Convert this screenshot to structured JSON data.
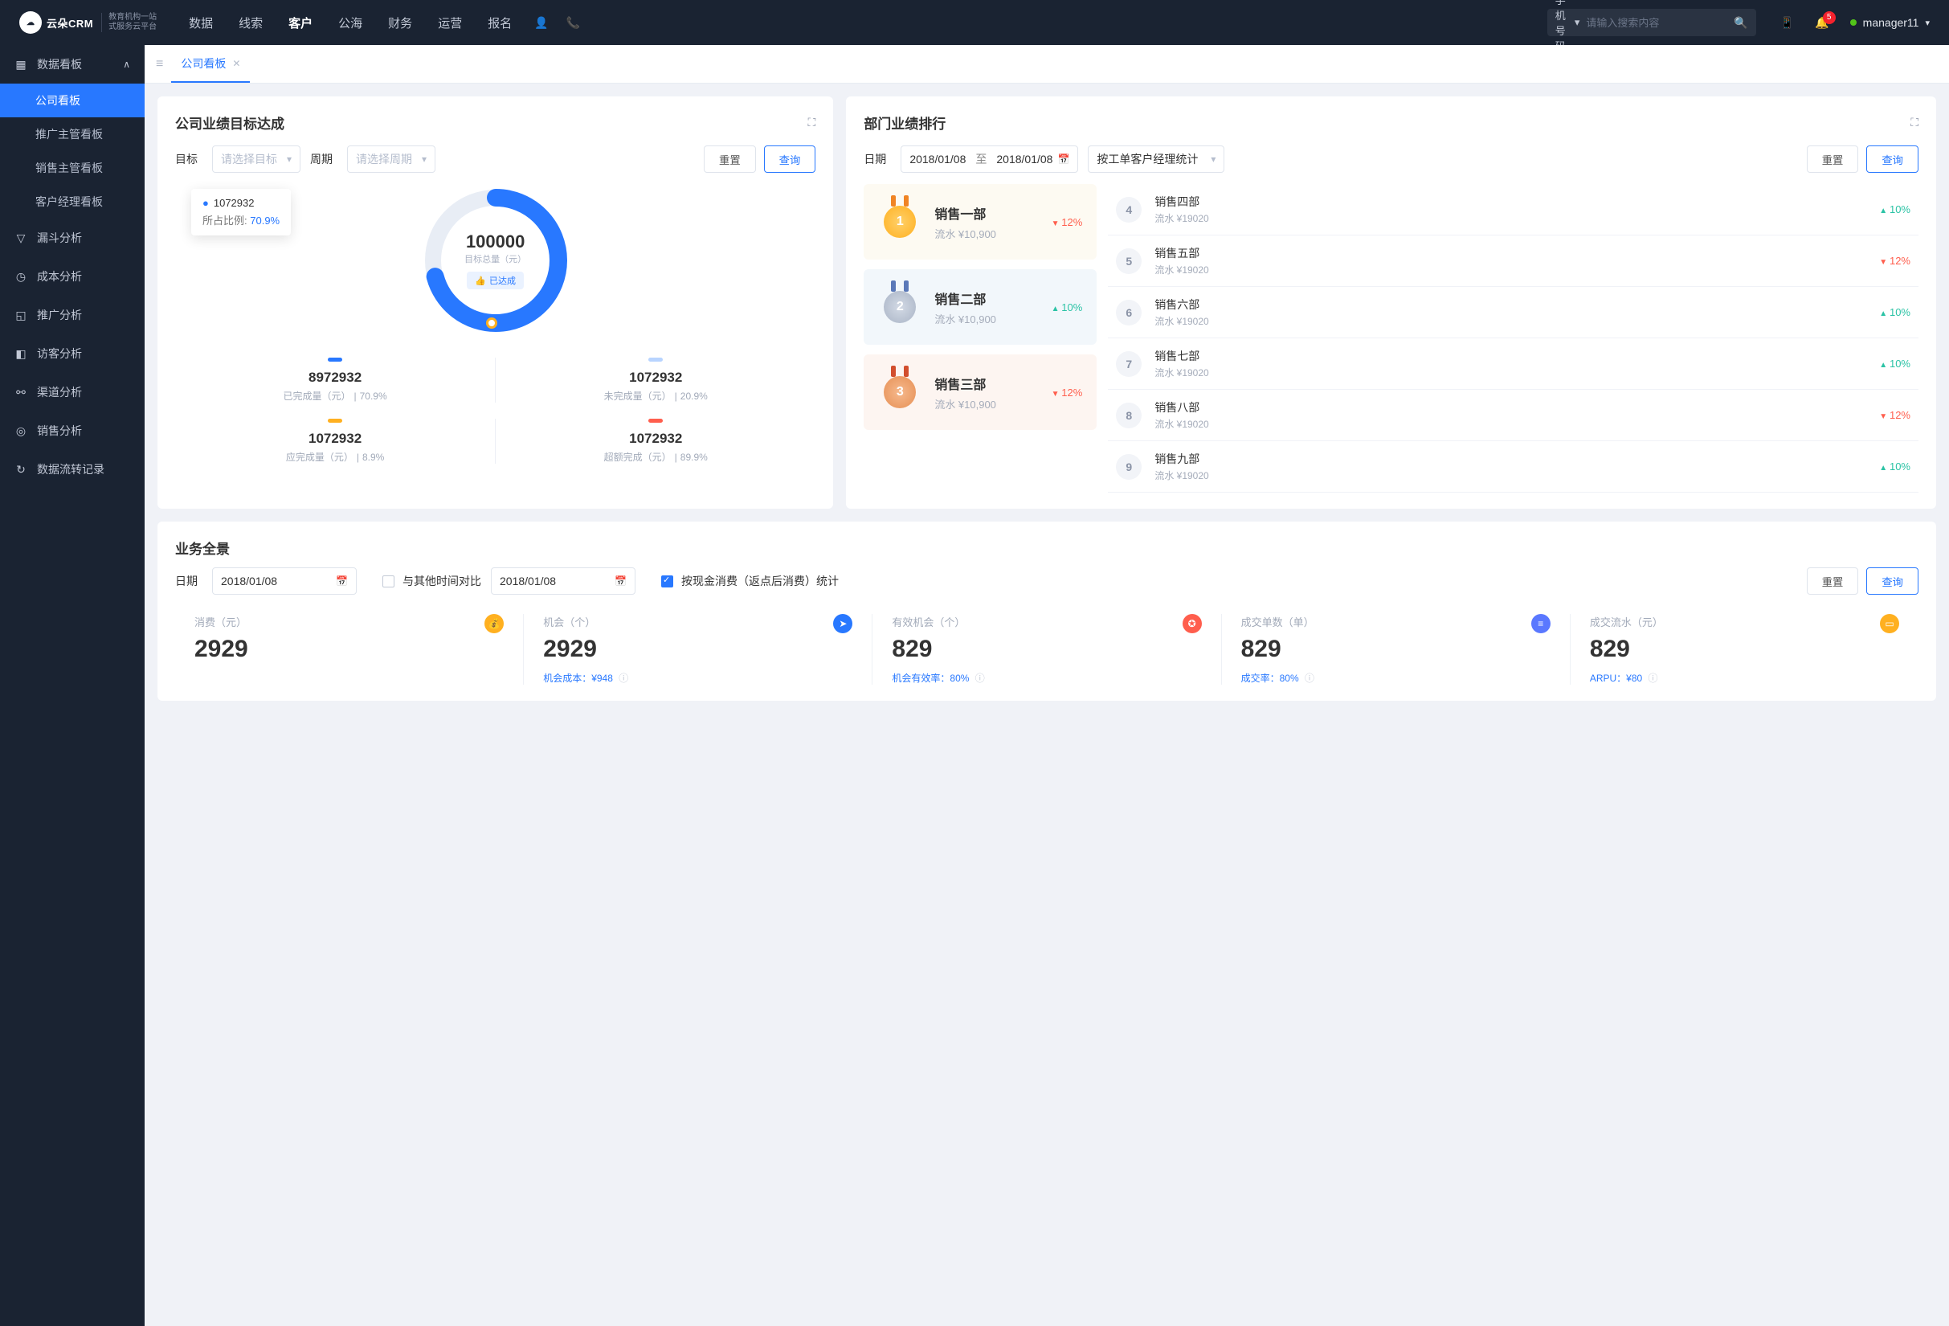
{
  "topnav": {
    "logo": "云朵CRM",
    "logo_tag1": "教育机构一站",
    "logo_tag2": "式服务云平台",
    "items": [
      "数据",
      "线索",
      "客户",
      "公海",
      "财务",
      "运营",
      "报名"
    ],
    "active_index": 2,
    "search_type": "手机号码",
    "search_placeholder": "请输入搜索内容",
    "badge": "5",
    "user": "manager11"
  },
  "sidebar": {
    "parent": "数据看板",
    "subs": [
      "公司看板",
      "推广主管看板",
      "销售主管看板",
      "客户经理看板"
    ],
    "active_sub": 0,
    "items": [
      "漏斗分析",
      "成本分析",
      "推广分析",
      "访客分析",
      "渠道分析",
      "销售分析",
      "数据流转记录"
    ]
  },
  "tab": {
    "label": "公司看板"
  },
  "target": {
    "title": "公司业绩目标达成",
    "goal_label": "目标",
    "goal_placeholder": "请选择目标",
    "period_label": "周期",
    "period_placeholder": "请选择周期",
    "reset": "重置",
    "query": "查询",
    "tooltip_val": "1072932",
    "tooltip_label": "所占比例:",
    "tooltip_pct": "70.9%",
    "center_val": "100000",
    "center_label": "目标总量（元）",
    "center_badge": "已达成",
    "stats": [
      {
        "bar": "#2878ff",
        "val": "8972932",
        "label": "已完成量（元）",
        "pct": "70.9%"
      },
      {
        "bar": "#b8d4ff",
        "val": "1072932",
        "label": "未完成量（元）",
        "pct": "20.9%"
      },
      {
        "bar": "#ffb020",
        "val": "1072932",
        "label": "应完成量（元）",
        "pct": "8.9%"
      },
      {
        "bar": "#ff5e4d",
        "val": "1072932",
        "label": "超额完成（元）",
        "pct": "89.9%"
      }
    ]
  },
  "ranking": {
    "title": "部门业绩排行",
    "date_label": "日期",
    "date_from": "2018/01/08",
    "date_sep": "至",
    "date_to": "2018/01/08",
    "group_by": "按工单客户经理统计",
    "reset": "重置",
    "query": "查询",
    "top3": [
      {
        "rank": "1",
        "name": "销售一部",
        "amt": "流水 ¥10,900",
        "pct": "12%",
        "dir": "down"
      },
      {
        "rank": "2",
        "name": "销售二部",
        "amt": "流水 ¥10,900",
        "pct": "10%",
        "dir": "up"
      },
      {
        "rank": "3",
        "name": "销售三部",
        "amt": "流水 ¥10,900",
        "pct": "12%",
        "dir": "down"
      }
    ],
    "rest": [
      {
        "rank": "4",
        "name": "销售四部",
        "amt": "流水 ¥19020",
        "pct": "10%",
        "dir": "up"
      },
      {
        "rank": "5",
        "name": "销售五部",
        "amt": "流水 ¥19020",
        "pct": "12%",
        "dir": "down"
      },
      {
        "rank": "6",
        "name": "销售六部",
        "amt": "流水 ¥19020",
        "pct": "10%",
        "dir": "up"
      },
      {
        "rank": "7",
        "name": "销售七部",
        "amt": "流水 ¥19020",
        "pct": "10%",
        "dir": "up"
      },
      {
        "rank": "8",
        "name": "销售八部",
        "amt": "流水 ¥19020",
        "pct": "12%",
        "dir": "down"
      },
      {
        "rank": "9",
        "name": "销售九部",
        "amt": "流水 ¥19020",
        "pct": "10%",
        "dir": "up"
      }
    ]
  },
  "overview": {
    "title": "业务全景",
    "date_label": "日期",
    "date1": "2018/01/08",
    "compare_label": "与其他时间对比",
    "date2": "2018/01/08",
    "check_label": "按现金消费（返点后消费）统计",
    "reset": "重置",
    "query": "查询",
    "kpis": [
      {
        "label": "消费（元）",
        "val": "2929",
        "icon": "#ffb020",
        "glyph": "💰",
        "sub": ""
      },
      {
        "label": "机会（个）",
        "val": "2929",
        "icon": "#2878ff",
        "glyph": "➤",
        "sub": "机会成本：¥948"
      },
      {
        "label": "有效机会（个）",
        "val": "829",
        "icon": "#ff5e4d",
        "glyph": "✪",
        "sub": "机会有效率：80%"
      },
      {
        "label": "成交单数（单）",
        "val": "829",
        "icon": "#5a78ff",
        "glyph": "≡",
        "sub": "成交率：80%"
      },
      {
        "label": "成交流水（元）",
        "val": "829",
        "icon": "#ffb020",
        "glyph": "▭",
        "sub": "ARPU：¥80"
      }
    ]
  },
  "chart_data": {
    "type": "pie",
    "title": "公司业绩目标达成",
    "total_label": "目标总量（元）",
    "total": 100000,
    "series": [
      {
        "name": "已完成量（元）",
        "value": 8972932,
        "pct": 70.9,
        "color": "#2878ff"
      },
      {
        "name": "未完成量（元）",
        "value": 1072932,
        "pct": 20.9,
        "color": "#b8d4ff"
      },
      {
        "name": "应完成量（元）",
        "value": 1072932,
        "pct": 8.9,
        "color": "#ffb020"
      },
      {
        "name": "超额完成（元）",
        "value": 1072932,
        "pct": 89.9,
        "color": "#ff5e4d"
      }
    ]
  }
}
